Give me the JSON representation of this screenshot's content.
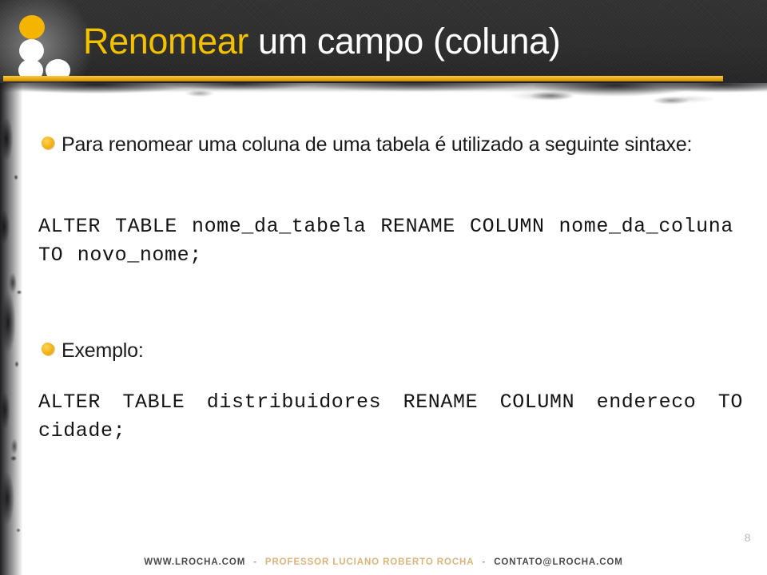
{
  "header": {
    "title_accent": "Renomear",
    "title_rest": " um campo (coluna)",
    "logo_name": "lrocha-dots-logo"
  },
  "content": {
    "bullet_1": "Para renomear uma coluna de uma tabela é utilizado a seguinte sintaxe:",
    "code_1": "ALTER TABLE nome_da_tabela RENAME COLUMN nome_da_coluna TO novo_nome;",
    "bullet_2": "Exemplo:",
    "code_2": "ALTER TABLE distribuidores RENAME COLUMN endereco TO cidade;"
  },
  "footer": {
    "site": "WWW.LROCHA.COM",
    "separator": "-",
    "author": "PROFESSOR LUCIANO ROBERTO ROCHA",
    "email": "CONTATO@LROCHA.COM",
    "page_number": "8"
  },
  "colors": {
    "header_bg": "#2e2e2e",
    "accent_gold": "#f2c200",
    "rule_gold": "#eeab13",
    "bullet_gold": "#f5b61d",
    "footer_gold": "#d9ae6e",
    "body_text": "#1a1a1a",
    "page_number": "#b9b9b9"
  }
}
